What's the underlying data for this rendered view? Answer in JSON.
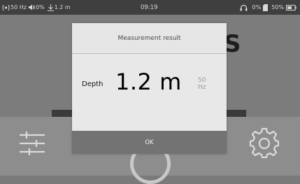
{
  "status_bar": {
    "frequency": "50 Hz",
    "volume": "0%",
    "depth": "1.2 m",
    "time": "09:19",
    "headphone_volume": "0%",
    "battery": "50%"
  },
  "background": {
    "partial_text": "S"
  },
  "dialog": {
    "title": "Measurement result",
    "depth_label": "Depth",
    "depth_value": "1.2 m",
    "frequency_value": "50",
    "frequency_unit": "Hz",
    "ok_label": "OK"
  },
  "icons": {
    "sliders": "sliders-icon",
    "gear": "gear-icon",
    "signal": "signal-icon",
    "speaker": "speaker-icon",
    "depth": "depth-icon",
    "headphones": "headphones-icon",
    "sd_card": "sd-card-icon",
    "battery": "battery-icon"
  },
  "colors": {
    "status_bar_bg": "#3f3f3f",
    "dialog_bg": "#e8e8e8",
    "ok_button_bg": "#737373"
  }
}
